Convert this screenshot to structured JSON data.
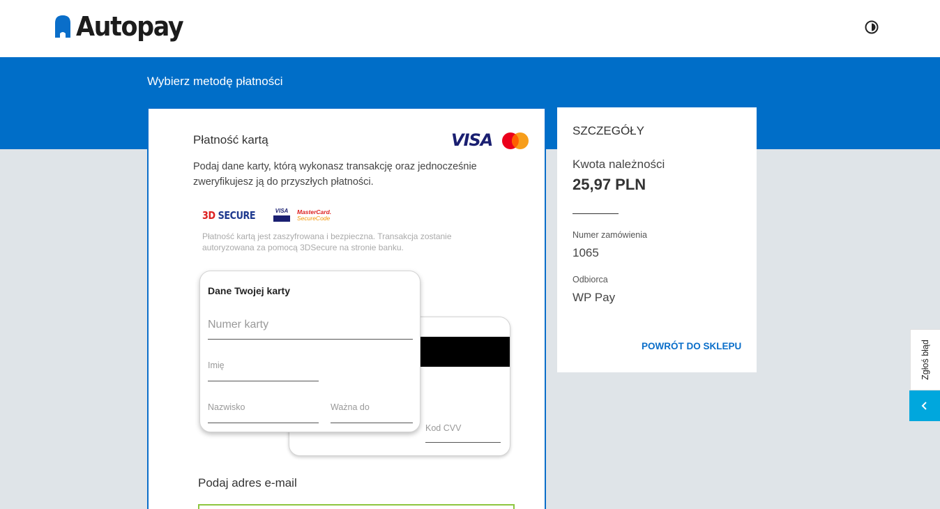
{
  "header": {
    "brand": "Autopay",
    "contrast_icon": "contrast-icon"
  },
  "page": {
    "heading": "Wybierz metodę płatności"
  },
  "payment": {
    "title": "Płatność kartą",
    "brand_visa": "VISA",
    "brand_mastercard": "mastercard-icon",
    "description": "Podaj dane karty, którą wykonasz transakcję oraz jednocześnie zweryfikujesz ją do przyszłych płatności.",
    "badges": {
      "threed_digit": "3D",
      "threed_word": "SECURE",
      "visa_secure": "VISA",
      "mc_line1": "MasterCard.",
      "mc_line2": "SecureCode"
    },
    "secure_note": "Płatność kartą jest zaszyfrowana i bezpieczna. Transakcja zostanie autoryzowana za pomocą 3DSecure na stronie banku.",
    "card_front_title": "Dane Twojej karty",
    "fields": {
      "card_number": "Numer karty",
      "first_name": "Imię",
      "last_name": "Nazwisko",
      "valid_until": "Ważna do",
      "cvv": "Kod CVV"
    },
    "email_title": "Podaj adres e-mail",
    "email_value": ""
  },
  "details": {
    "title": "SZCZEGÓŁY",
    "amount_label": "Kwota należności",
    "amount_value": "25,97 PLN",
    "order_label": "Numer zamówienia",
    "order_value": "1065",
    "recipient_label": "Odbiorca",
    "recipient_value": "WP Pay",
    "back_link": "POWRÓT DO SKLEPU"
  },
  "side": {
    "report_label": "Zgłoś błąd",
    "collapse_icon": "chevron-left-icon"
  },
  "colors": {
    "primary_blue": "#006ec8",
    "accent_cyan": "#00a7dd",
    "email_border": "#8dc63f",
    "background": "#dfe4e8"
  }
}
